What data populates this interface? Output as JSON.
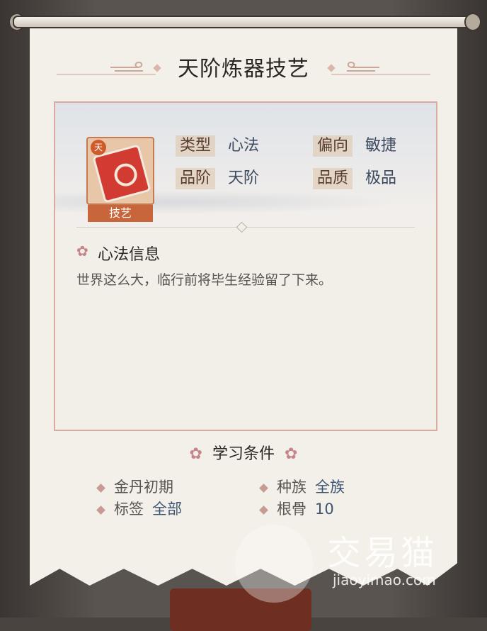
{
  "title": "天阶炼器技艺",
  "item": {
    "badge": "天",
    "label": "技艺"
  },
  "attributes": [
    {
      "key": "类型",
      "value": "心法"
    },
    {
      "key": "偏向",
      "value": "敏捷"
    },
    {
      "key": "品阶",
      "value": "天阶"
    },
    {
      "key": "品质",
      "value": "极品"
    }
  ],
  "info": {
    "heading": "心法信息",
    "description": "世界这么大，临行前将毕生经验留了下来。"
  },
  "requirements": {
    "heading": "学习条件",
    "items": [
      {
        "key": "金丹初期",
        "value": ""
      },
      {
        "key": "种族",
        "value": "全族"
      },
      {
        "key": "标签",
        "value": "全部"
      },
      {
        "key": "根骨",
        "value": "10"
      }
    ]
  },
  "watermark": {
    "name": "交易猫",
    "url": "jiaoyimao.com"
  },
  "colors": {
    "paper": "#f3efe9",
    "accent": "#c9653b",
    "value_text": "#3d5472"
  }
}
